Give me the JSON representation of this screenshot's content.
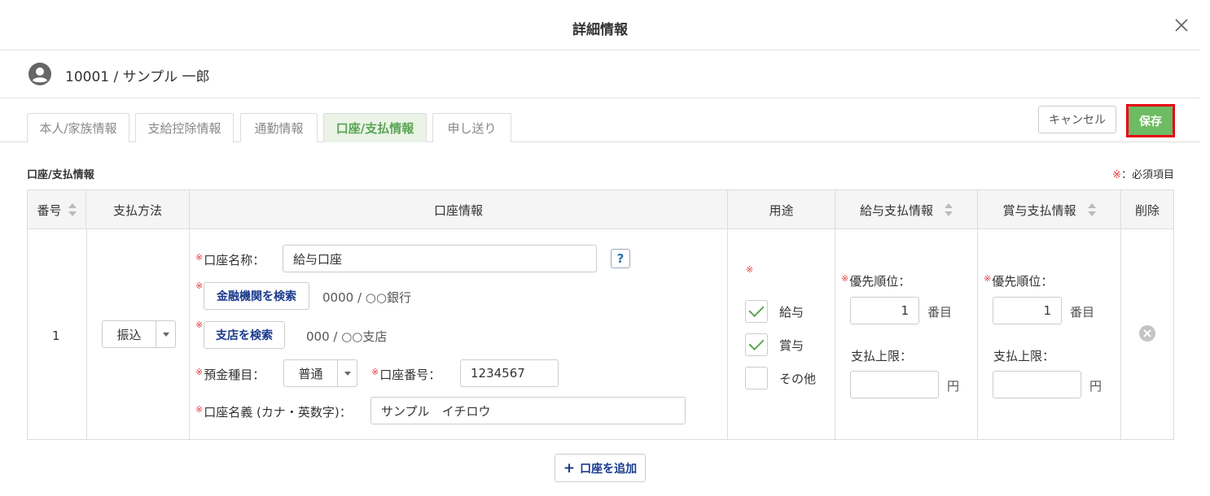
{
  "dialog": {
    "title": "詳細情報",
    "close_icon": "close-icon"
  },
  "user": {
    "label": "10001 / サンプル 一郎",
    "avatar_icon": "user-circle-icon"
  },
  "tabs": [
    {
      "label": "本人/家族情報",
      "active": false
    },
    {
      "label": "支給控除情報",
      "active": false
    },
    {
      "label": "通勤情報",
      "active": false
    },
    {
      "label": "口座/支払情報",
      "active": true
    },
    {
      "label": "申し送り",
      "active": false
    }
  ],
  "actions": {
    "cancel_label": "キャンセル",
    "save_label": "保存"
  },
  "section": {
    "title": "口座/支払情報",
    "required_mark": "※",
    "required_text": "：必須項目"
  },
  "table": {
    "headers": [
      "番号",
      "支払方法",
      "口座情報",
      "用途",
      "給与支払情報",
      "賞与支払情報",
      "削除"
    ],
    "row": {
      "number": "1",
      "payment_method": "振込",
      "account": {
        "name_label": "口座名称：",
        "name_value": "給与口座",
        "help": "?",
        "bank_search_label": "金融機関を検索",
        "bank_value": "0000 / ○○銀行",
        "branch_search_label": "支店を検索",
        "branch_value": "000 / ○○支店",
        "deposit_type_label": "預金種目：",
        "deposit_type_value": "普通",
        "account_number_label": "口座番号：",
        "account_number_value": "1234567",
        "holder_label": "口座名義 (カナ・英数字)：",
        "holder_value": "サンプル　イチロウ"
      },
      "usage": {
        "required_mark": "※",
        "options": [
          {
            "label": "給与",
            "checked": true
          },
          {
            "label": "賞与",
            "checked": true
          },
          {
            "label": "その他",
            "checked": false
          }
        ]
      },
      "salary": {
        "priority_label": "優先順位：",
        "priority_value": "1",
        "priority_unit": "番目",
        "limit_label": "支払上限：",
        "limit_value": "",
        "limit_unit": "円"
      },
      "bonus": {
        "priority_label": "優先順位：",
        "priority_value": "1",
        "priority_unit": "番目",
        "limit_label": "支払上限：",
        "limit_value": "",
        "limit_unit": "円"
      }
    }
  },
  "add_account_label": "口座を追加",
  "colors": {
    "accent_green": "#5aa454",
    "save_bg": "#6dbb63",
    "required_red": "#e8383d",
    "link_blue": "#1a3a8c",
    "highlight_border": "#e60012"
  }
}
